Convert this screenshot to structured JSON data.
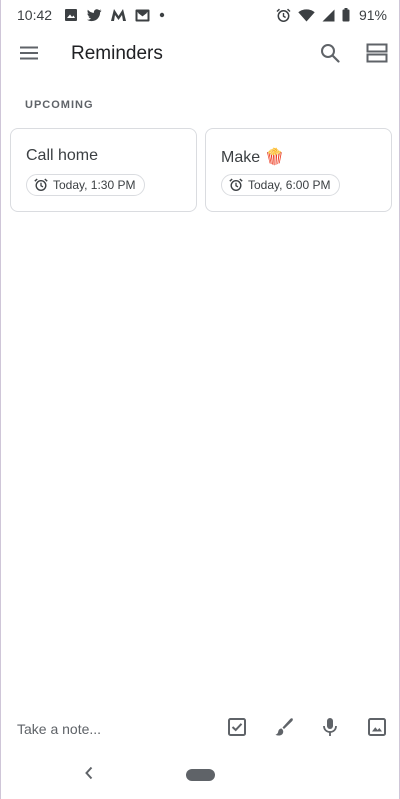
{
  "status_bar": {
    "time": "10:42",
    "battery": "91%",
    "left_icons": [
      "image-icon",
      "twitter-icon",
      "m-logo-icon",
      "mail-icon",
      "dot-icon"
    ],
    "right_icons": [
      "alarm-icon",
      "wifi-icon",
      "signal-icon",
      "battery-icon"
    ]
  },
  "app_bar": {
    "title": "Reminders"
  },
  "section": {
    "label": "UPCOMING"
  },
  "reminders": [
    {
      "title": "Call home",
      "time": "Today, 1:30 PM"
    },
    {
      "title": "Make 🍿",
      "time": "Today, 6:00 PM"
    }
  ],
  "bottom_bar": {
    "note_placeholder": "Take a note..."
  },
  "colors": {
    "text": "#202124",
    "secondary": "#5f6368",
    "border": "#dadce0"
  }
}
